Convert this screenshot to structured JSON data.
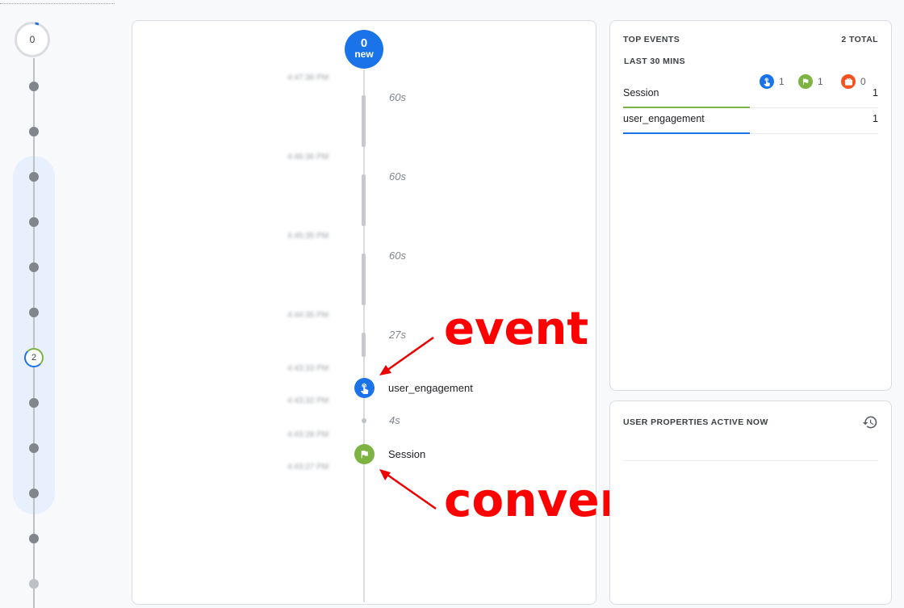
{
  "mini_timeline": {
    "top_count": "0",
    "group_count": "2"
  },
  "stream": {
    "new_count": "0",
    "new_label": "new",
    "timestamps": [
      "4:47:36 PM",
      "4:46:36 PM",
      "4:45:35 PM",
      "4:44:35 PM",
      "4:43:33 PM",
      "4:43:32 PM",
      "4:43:28 PM",
      "4:43:27 PM"
    ],
    "durations": [
      "60s",
      "60s",
      "60s",
      "27s",
      "4s"
    ],
    "events": [
      {
        "name": "user_engagement",
        "icon": "touch-icon",
        "color": "#1a73e8"
      },
      {
        "name": "Session",
        "icon": "flag-icon",
        "color": "#7cb342"
      }
    ]
  },
  "annotations": {
    "event": "event",
    "conversion": "conversion"
  },
  "top_events": {
    "title": "TOP EVENTS",
    "total": "2 TOTAL",
    "period": "LAST 30 MINS",
    "stats": [
      {
        "icon": "touch-icon",
        "color": "#1a73e8",
        "value": "1"
      },
      {
        "icon": "flag-icon",
        "color": "#7cb342",
        "value": "1"
      },
      {
        "icon": "gift-icon",
        "color": "#f4511e",
        "value": "0"
      }
    ],
    "rows": [
      {
        "name": "Session",
        "count": "1",
        "color": "#7cb342"
      },
      {
        "name": "user_engagement",
        "count": "1",
        "color": "#1a73e8"
      }
    ]
  },
  "user_properties": {
    "title": "USER PROPERTIES ACTIVE NOW"
  }
}
